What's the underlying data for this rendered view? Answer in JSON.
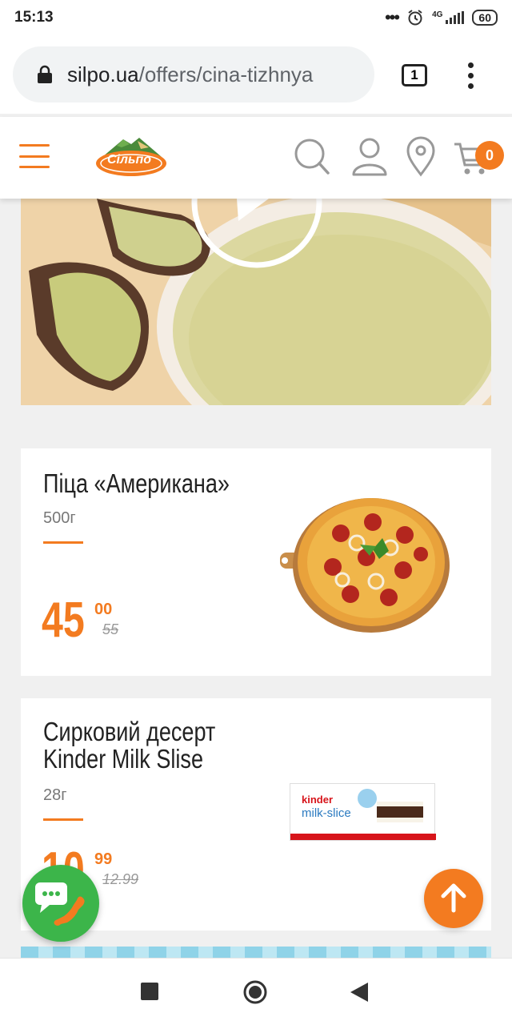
{
  "status": {
    "time": "15:13",
    "network": "4G",
    "battery": "60"
  },
  "browser": {
    "url_domain": "silpo.ua",
    "url_path": "/offers/cina-tizhnya",
    "tab_count": "1"
  },
  "header": {
    "logo_text": "Сільпо",
    "cart_count": "0"
  },
  "products": [
    {
      "title": "Піца «Американа»",
      "weight": "500г",
      "price_main": "45",
      "price_cents": "00",
      "price_old": "55",
      "image": "pizza"
    },
    {
      "title_line1": "Сирковий десерт",
      "title_line2": "Kinder Milk Slise",
      "weight": "28г",
      "price_main": "10",
      "price_cents": "99",
      "price_old": "12.99",
      "image": "kinder-milk-slice",
      "pack_brand": "kinder",
      "pack_name": "milk-slice"
    }
  ],
  "colors": {
    "accent": "#f37b20",
    "chat": "#3cb54a"
  },
  "icons": [
    "lock-icon",
    "tab-switcher-icon",
    "more-menu-icon",
    "hamburger-icon",
    "search-icon",
    "user-icon",
    "location-icon",
    "cart-icon",
    "play-icon",
    "chat-phone-icon",
    "arrow-up-icon",
    "nav-square-icon",
    "nav-circle-icon",
    "nav-back-icon"
  ]
}
